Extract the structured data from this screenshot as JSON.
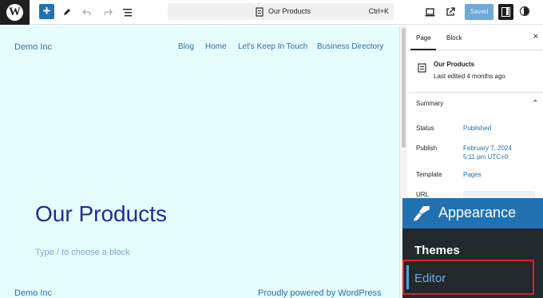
{
  "toolbar": {
    "logo_glyph": "W",
    "add_symbol": "+",
    "document_title": "Our Products",
    "shortcut": "Ctrl+K",
    "saved_label": "Saved",
    "icons": [
      "wordpress-logo",
      "add-icon",
      "pen-icon",
      "undo-icon",
      "redo-icon",
      "list-view-icon",
      "document-icon",
      "desktop-view-icon",
      "external-link-icon",
      "settings-panel-icon",
      "styles-contrast-icon"
    ]
  },
  "canvas": {
    "site_title": "Demo Inc",
    "nav": [
      "Blog",
      "Home",
      "Let's Keep In Touch",
      "Business Directory"
    ],
    "page_heading": "Our Products",
    "block_hint": "Type / to choose a block",
    "footer_title": "Demo Inc",
    "footer_credit": "Proudly powered by WordPress",
    "background_color": "#e6fdfe",
    "link_color": "#2e6ea8",
    "heading_color": "#1a2f8f"
  },
  "sidebar": {
    "tabs": [
      "Page",
      "Block"
    ],
    "active_tab": "Page",
    "close_symbol": "×",
    "page_title": "Our Products",
    "page_meta": "Last edited 4 months ago",
    "summary_label": "Summary",
    "chevron": "⌄",
    "rows": {
      "status": {
        "label": "Status",
        "value": "Published"
      },
      "publish": {
        "label": "Publish",
        "value_line1": "February 7, 2024",
        "value_line2": "5:11 pm UTC+0"
      },
      "template": {
        "label": "Template",
        "value": "Pages"
      },
      "url": {
        "label": "URL"
      }
    }
  },
  "appearance_menu": {
    "header": "Appearance",
    "submenu_title": "Themes",
    "editor_item": "Editor",
    "highlight_color": "#e0202a",
    "header_color": "#2271b1",
    "menu_bg": "#23282d"
  }
}
